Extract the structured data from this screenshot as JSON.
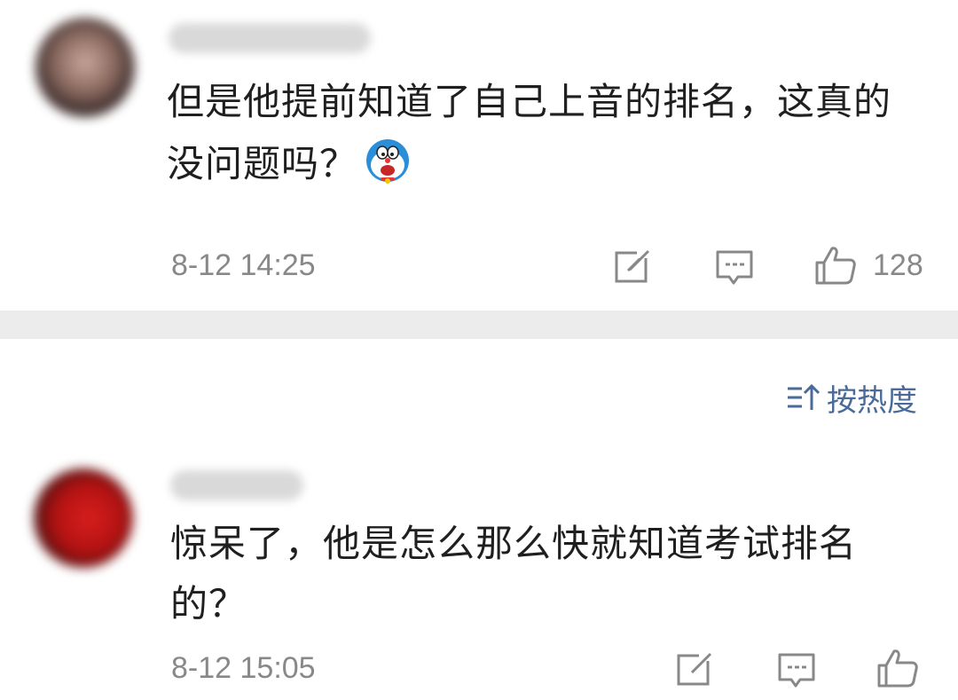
{
  "comments": [
    {
      "text_line1": "但是他提前知道了自己上音的排名，这真的",
      "text_line2": "没问题吗？",
      "emoji": "doraemon-emoji",
      "time": "8-12 14:25",
      "likes": "128"
    },
    {
      "text_line1": "惊呆了，他是怎么那么快就知道考试排名",
      "text_line2": "的？",
      "time": "8-12 15:05",
      "likes": ""
    }
  ],
  "sort": {
    "label": "按热度",
    "icon": "sort-icon"
  },
  "icons": [
    "share-icon",
    "reply-icon",
    "like-icon"
  ],
  "colors": {
    "link": "#4a6b9a",
    "meta": "#888888",
    "text": "#1f1f1f",
    "divider": "#ececec"
  }
}
